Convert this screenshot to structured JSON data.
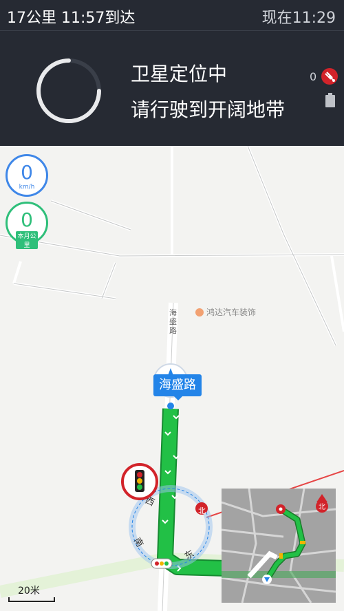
{
  "status_bar": {
    "remaining": "17公里  11:57到达",
    "now": "现在11:29"
  },
  "gps": {
    "line1": "卫星定位中",
    "line2": "请行驶到开阔地带",
    "satellites": "0"
  },
  "badges": {
    "speed_value": "0",
    "speed_unit": "km/h",
    "month_value": "0",
    "month_unit": "本月公里"
  },
  "map": {
    "road_name": "海盛路",
    "poi": "鸿达汽车装饰",
    "vertical_road": "海盛路",
    "compass": {
      "north": "北",
      "west": "西",
      "south": "南",
      "east": "东"
    },
    "scale": "20米"
  },
  "colors": {
    "route": "#22c046",
    "route_border": "#168a31",
    "accent": "#2384e8",
    "alert": "#d2232a"
  },
  "icons": [
    "loading-spinner-icon",
    "satellite-icon",
    "battery-icon",
    "traffic-light-icon",
    "navigation-arrow-icon",
    "north-arrow-icon"
  ]
}
